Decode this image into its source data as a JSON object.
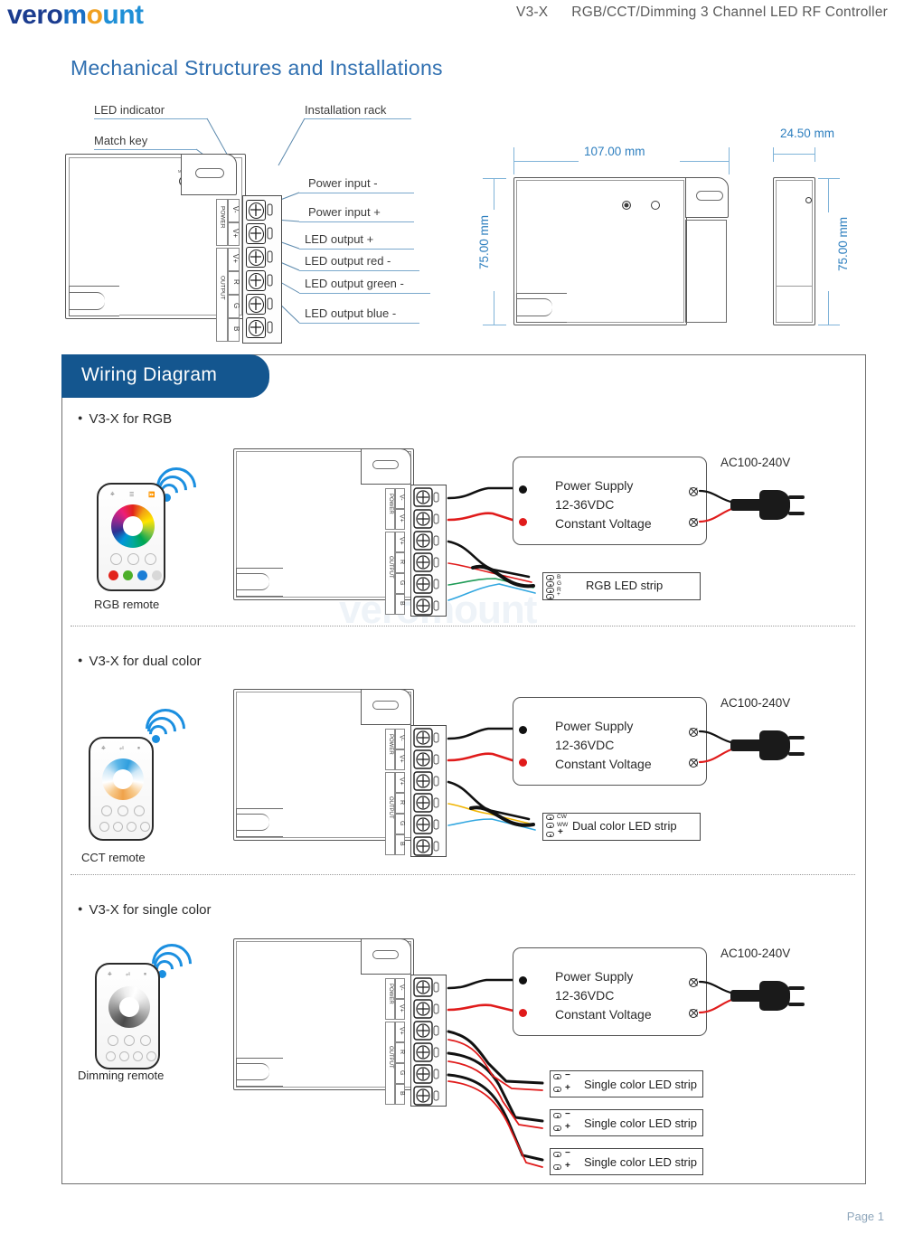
{
  "header": {
    "logo_part1": "vero",
    "logo_part2": "m",
    "logo_part3": "o",
    "logo_part4": "unt",
    "model": "V3-X",
    "title": "RGB/CCT/Dimming 3 Channel LED RF Controller"
  },
  "mechanical": {
    "section_title": "Mechanical Structures and Installations",
    "callouts": {
      "led_indicator": "LED indicator",
      "match_key": "Match key",
      "installation_rack": "Installation rack",
      "power_input_minus": "Power input -",
      "power_input_plus": "Power input +",
      "led_output_plus": "LED output +",
      "led_output_red": "LED output red -",
      "led_output_green": "LED output green -",
      "led_output_blue": "LED output blue -"
    },
    "device_marks": {
      "match": "MATCH",
      "run": "RUN"
    },
    "terminal_groups": {
      "power_label": "POWER",
      "output_label": "OUTPUT",
      "power_pins": [
        "V-",
        "V+"
      ],
      "output_pins": [
        "V+",
        "R",
        "G",
        "B"
      ]
    },
    "dimensions": {
      "width": "107.00 mm",
      "height": "75.00 mm",
      "depth": "24.50 mm",
      "side_height": "75.00 mm"
    }
  },
  "wiring": {
    "banner": "Wiring Diagram",
    "sections": [
      {
        "heading": "V3-X for RGB",
        "remote_caption": "RGB remote",
        "psu_lines": [
          "Power Supply",
          "12-36VDC",
          "Constant Voltage"
        ],
        "ac_label": "AC100-240V",
        "strips": [
          {
            "label": "RGB LED strip",
            "pads": [
              "B",
              "G",
              "R",
              "+"
            ]
          }
        ]
      },
      {
        "heading": "V3-X for dual color",
        "remote_caption": "CCT remote",
        "psu_lines": [
          "Power Supply",
          "12-36VDC",
          "Constant Voltage"
        ],
        "ac_label": "AC100-240V",
        "strips": [
          {
            "label": "Dual color LED strip",
            "pads": [
              "CW",
              "WW",
              "+"
            ]
          }
        ]
      },
      {
        "heading": "V3-X for single color",
        "remote_caption": "Dimming remote",
        "psu_lines": [
          "Power Supply",
          "12-36VDC",
          "Constant Voltage"
        ],
        "ac_label": "AC100-240V",
        "strips": [
          {
            "label": "Single color LED strip",
            "pads": [
              "−",
              "+"
            ]
          },
          {
            "label": "Single color LED strip",
            "pads": [
              "−",
              "+"
            ]
          },
          {
            "label": "Single color LED strip",
            "pads": [
              "−",
              "+"
            ]
          }
        ]
      }
    ]
  },
  "watermark": "veromount",
  "footer": {
    "page": "Page 1"
  },
  "colors": {
    "brand_blue": "#14568f",
    "heading_blue": "#2f6fb0",
    "dim_blue": "#2e7fbf",
    "wire_red": "#e01b1b",
    "wire_black": "#111111",
    "wire_green": "#1f9b57",
    "wire_blue": "#32a7e0",
    "rf_blue": "#1b8fe0"
  }
}
